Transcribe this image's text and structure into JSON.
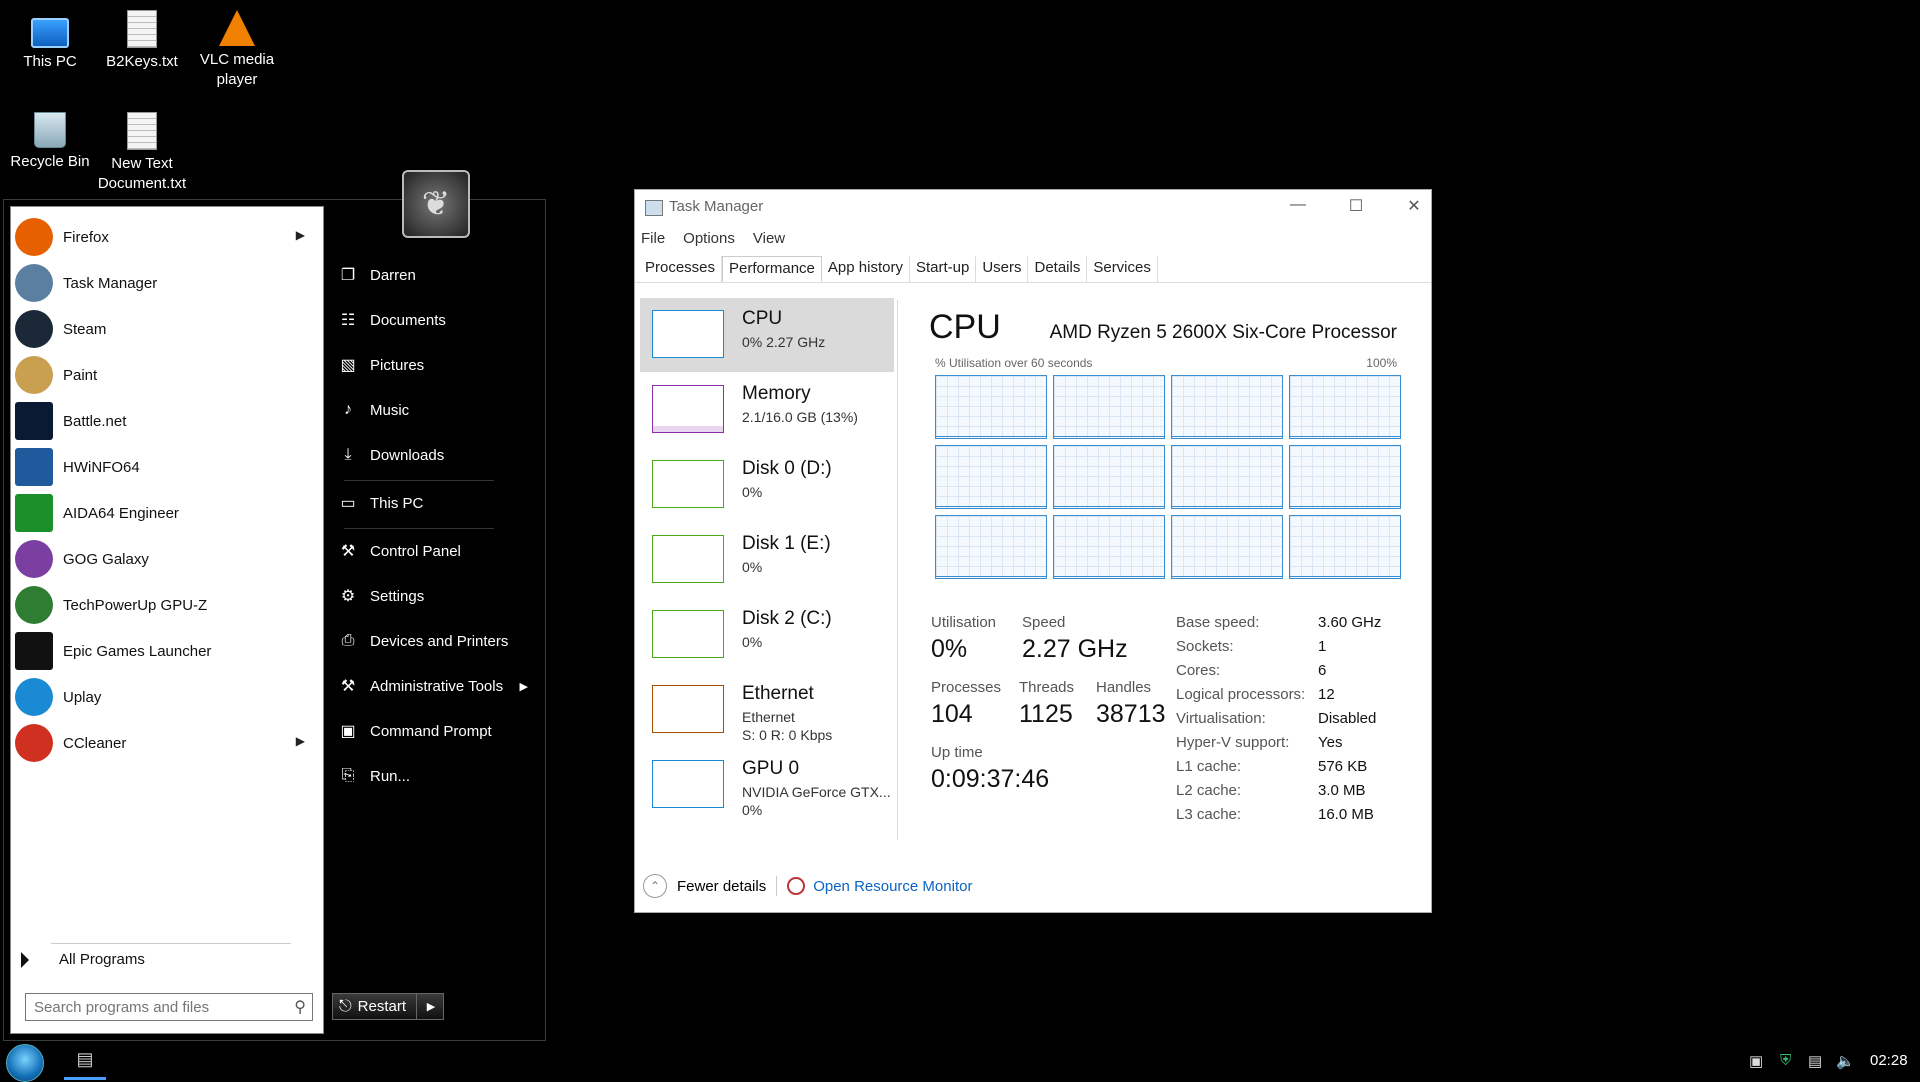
{
  "desktop": {
    "icons": [
      {
        "label": "This PC",
        "icon": "pc-icon"
      },
      {
        "label": "B2Keys.txt",
        "icon": "text-file-icon"
      },
      {
        "label": "VLC media player",
        "icon": "vlc-icon"
      },
      {
        "label": "Recycle Bin",
        "icon": "recycle-bin-icon"
      },
      {
        "label": "New Text Document.txt",
        "icon": "text-file-icon"
      }
    ]
  },
  "start_menu": {
    "programs": [
      {
        "label": "Firefox",
        "icon": "firefox-icon",
        "color": "#e66000",
        "submenu": true
      },
      {
        "label": "Task Manager",
        "icon": "task-manager-icon",
        "color": "#5a7fa0",
        "submenu": false
      },
      {
        "label": "Steam",
        "icon": "steam-icon",
        "color": "#1b2838",
        "submenu": false
      },
      {
        "label": "Paint",
        "icon": "paint-icon",
        "color": "#c8a050",
        "submenu": false
      },
      {
        "label": "Battle.net",
        "icon": "battlenet-icon",
        "color": "#0a1a33",
        "submenu": false
      },
      {
        "label": "HWiNFO64",
        "icon": "hwinfo-icon",
        "color": "#1e5a9c",
        "submenu": false
      },
      {
        "label": "AIDA64 Engineer",
        "icon": "aida64-icon",
        "color": "#1a8f2a",
        "submenu": false
      },
      {
        "label": "GOG Galaxy",
        "icon": "gog-icon",
        "color": "#7a3fa0",
        "submenu": false
      },
      {
        "label": "TechPowerUp GPU-Z",
        "icon": "gpuz-icon",
        "color": "#2e7d32",
        "submenu": false
      },
      {
        "label": "Epic Games Launcher",
        "icon": "epic-icon",
        "color": "#111111",
        "submenu": false
      },
      {
        "label": "Uplay",
        "icon": "uplay-icon",
        "color": "#1a8ad4",
        "submenu": false
      },
      {
        "label": "CCleaner",
        "icon": "ccleaner-icon",
        "color": "#d03020",
        "submenu": true
      }
    ],
    "all_programs": "All Programs",
    "search_placeholder": "Search programs and files",
    "places": [
      {
        "label": "Darren",
        "icon": "user-icon",
        "glyph": "❐"
      },
      {
        "label": "Documents",
        "icon": "documents-icon",
        "glyph": "☷"
      },
      {
        "label": "Pictures",
        "icon": "pictures-icon",
        "glyph": "▧"
      },
      {
        "label": "Music",
        "icon": "music-icon",
        "glyph": "♪"
      },
      {
        "label": "Downloads",
        "icon": "downloads-icon",
        "glyph": "⤓"
      },
      {
        "label": "This PC",
        "icon": "computer-icon",
        "glyph": "▭"
      },
      {
        "label": "Control Panel",
        "icon": "control-panel-icon",
        "glyph": "⚒"
      },
      {
        "label": "Settings",
        "icon": "settings-icon",
        "glyph": "⚙"
      },
      {
        "label": "Devices and Printers",
        "icon": "printer-icon",
        "glyph": "⎙"
      },
      {
        "label": "Administrative Tools",
        "icon": "admin-tools-icon",
        "glyph": "⚒",
        "submenu": true
      },
      {
        "label": "Command Prompt",
        "icon": "command-prompt-icon",
        "glyph": "▣"
      },
      {
        "label": "Run...",
        "icon": "run-icon",
        "glyph": "⎘"
      }
    ],
    "restart_label": "Restart"
  },
  "task_manager": {
    "title": "Task Manager",
    "menu": [
      "File",
      "Options",
      "View"
    ],
    "tabs": [
      "Processes",
      "Performance",
      "App history",
      "Start-up",
      "Users",
      "Details",
      "Services"
    ],
    "active_tab": "Performance",
    "sidebar": [
      {
        "name": "CPU",
        "line1": "0%  2.27 GHz",
        "line2": "",
        "color": "#1a8ad4",
        "selected": true
      },
      {
        "name": "Memory",
        "line1": "2.1/16.0 GB (13%)",
        "line2": "",
        "color": "#8b2fa8",
        "selected": false
      },
      {
        "name": "Disk 0 (D:)",
        "line1": "0%",
        "line2": "",
        "color": "#4caa14",
        "selected": false
      },
      {
        "name": "Disk 1 (E:)",
        "line1": "0%",
        "line2": "",
        "color": "#4caa14",
        "selected": false
      },
      {
        "name": "Disk 2 (C:)",
        "line1": "0%",
        "line2": "",
        "color": "#4caa14",
        "selected": false
      },
      {
        "name": "Ethernet",
        "line1": "Ethernet",
        "line2": "S: 0  R: 0 Kbps",
        "color": "#a74f01",
        "selected": false
      },
      {
        "name": "GPU 0",
        "line1": "NVIDIA GeForce GTX...",
        "line2": "0%",
        "color": "#1a8ad4",
        "selected": false
      }
    ],
    "cpu": {
      "heading": "CPU",
      "processor": "AMD Ryzen 5 2600X Six-Core Processor",
      "util_label": "% Utilisation over 60 seconds",
      "util_max": "100%",
      "logical_processor_count": 12,
      "stats": {
        "utilisation_label": "Utilisation",
        "utilisation": "0%",
        "speed_label": "Speed",
        "speed": "2.27 GHz",
        "processes_label": "Processes",
        "processes": "104",
        "threads_label": "Threads",
        "threads": "1125",
        "handles_label": "Handles",
        "handles": "38713",
        "uptime_label": "Up time",
        "uptime": "0:09:37:46"
      },
      "specs": [
        {
          "k": "Base speed:",
          "v": "3.60 GHz"
        },
        {
          "k": "Sockets:",
          "v": "1"
        },
        {
          "k": "Cores:",
          "v": "6"
        },
        {
          "k": "Logical processors:",
          "v": "12"
        },
        {
          "k": "Virtualisation:",
          "v": "Disabled"
        },
        {
          "k": "Hyper-V support:",
          "v": "Yes"
        },
        {
          "k": "L1 cache:",
          "v": "576 KB"
        },
        {
          "k": "L2 cache:",
          "v": "3.0 MB"
        },
        {
          "k": "L3 cache:",
          "v": "16.0 MB"
        }
      ]
    },
    "footer": {
      "fewer_details": "Fewer details",
      "open_resource_monitor": "Open Resource Monitor"
    }
  },
  "taskbar": {
    "clock": "02:28",
    "tray_icons": [
      "action-center-icon",
      "security-shield-icon",
      "network-icon",
      "volume-icon"
    ]
  }
}
